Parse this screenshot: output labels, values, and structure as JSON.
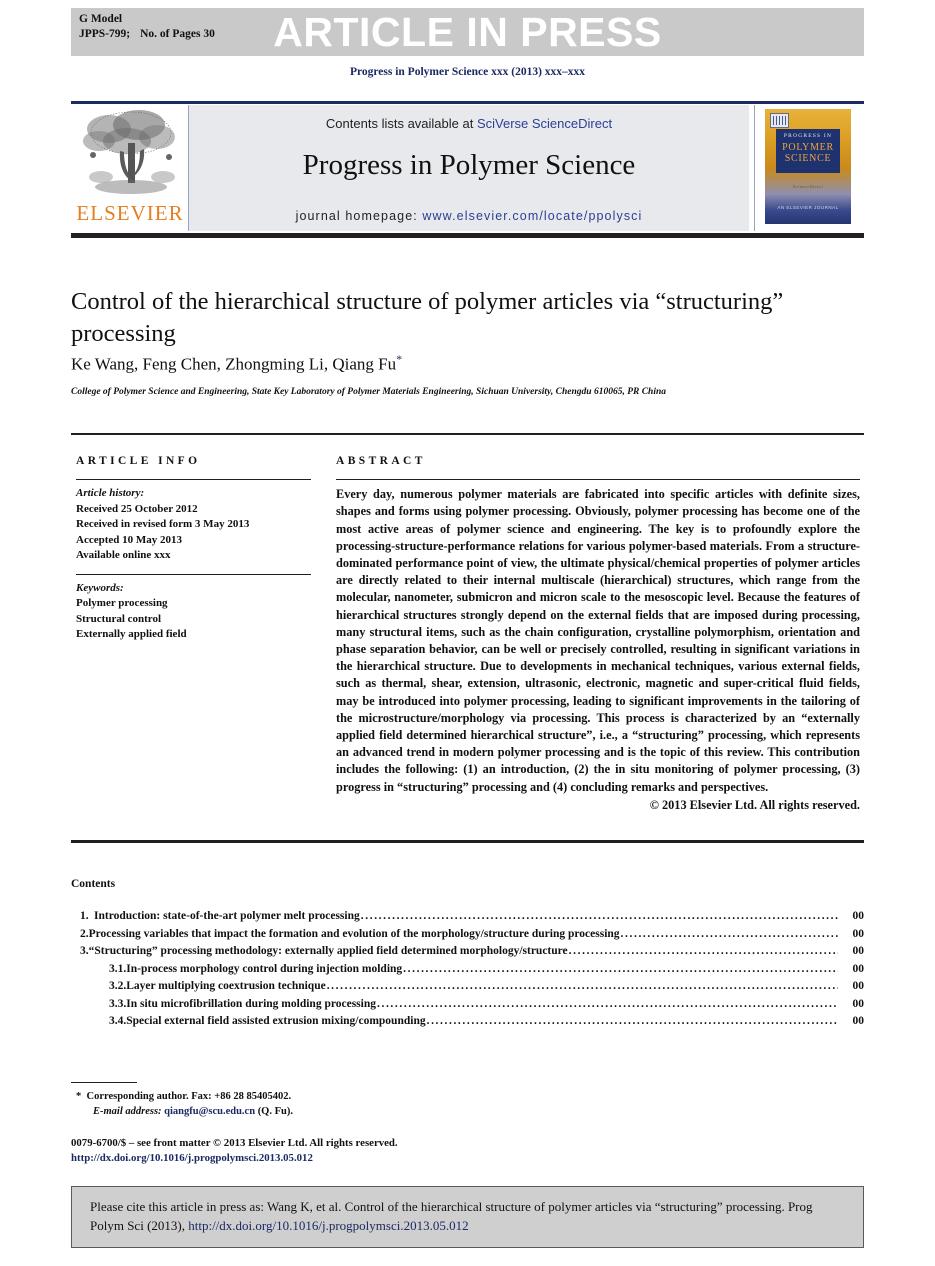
{
  "banner": {
    "gmodel_label": "G Model",
    "journal_code": "JPPS-799;",
    "pages_label": "No. of Pages 30",
    "press_title": "ARTICLE IN PRESS",
    "bg_color": "#c9c9c9"
  },
  "journal_line": "Progress in Polymer Science xxx (2013) xxx–xxx",
  "masthead": {
    "publisher": "ELSEVIER",
    "contents_prefix": "Contents lists available at ",
    "contents_link": "SciVerse ScienceDirect",
    "journal_name": "Progress in Polymer Science",
    "homepage_label": "journal homepage: ",
    "homepage_url": "www.elsevier.com/locate/ppolysci",
    "cover": {
      "top_line": "PROGRESS IN",
      "main_line_1": "POLYMER",
      "main_line_2": "SCIENCE",
      "mid_line": "ScienceDirect",
      "bottom_line": "AN ELSEVIER JOURNAL",
      "accent_color": "#efa63a",
      "panel_color": "#1f3270"
    },
    "link_color": "#2b3f92"
  },
  "article": {
    "title": "Control of the hierarchical structure of polymer articles via “structuring” processing",
    "authors": "Ke Wang, Feng Chen, Zhongming Li, Qiang Fu",
    "author_star": "*",
    "affiliation": "College of Polymer Science and Engineering, State Key Laboratory of Polymer Materials Engineering, Sichuan University, Chengdu 610065, PR China"
  },
  "info": {
    "heading": "ARTICLE INFO",
    "history_label": "Article history:",
    "history": [
      "Received 25 October 2012",
      "Received in revised form 3 May 2013",
      "Accepted 10 May 2013",
      "Available online xxx"
    ],
    "keywords_label": "Keywords:",
    "keywords": [
      "Polymer processing",
      "Structural control",
      "Externally applied field"
    ]
  },
  "abstract": {
    "heading": "ABSTRACT",
    "body": "Every day, numerous polymer materials are fabricated into specific articles with definite sizes, shapes and forms using polymer processing. Obviously, polymer processing has become one of the most active areas of polymer science and engineering. The key is to profoundly explore the processing-structure-performance relations for various polymer-based materials. From a structure-dominated performance point of view, the ultimate physical/chemical properties of polymer articles are directly related to their internal multiscale (hierarchical) structures, which range from the molecular, nanometer, submicron and micron scale to the mesoscopic level. Because the features of hierarchical structures strongly depend on the external fields that are imposed during processing, many structural items, such as the chain configuration, crystalline polymorphism, orientation and phase separation behavior, can be well or precisely controlled, resulting in significant variations in the hierarchical structure. Due to developments in mechanical techniques, various external fields, such as thermal, shear, extension, ultrasonic, electronic, magnetic and super-critical fluid fields, may be introduced into polymer processing, leading to significant improvements in the tailoring of the microstructure/morphology via processing. This process is characterized by an “externally applied field determined hierarchical structure”, i.e., a “structuring” processing, which represents an advanced trend in modern polymer processing and is the topic of this review. This contribution includes the following: (1) an introduction, (2) the in situ monitoring of polymer processing, (3) progress in “structuring” processing and (4) concluding remarks and perspectives.",
    "copyright": "© 2013 Elsevier Ltd. All rights reserved."
  },
  "contents": {
    "heading": "Contents",
    "entries": [
      {
        "level": 1,
        "num": "1.",
        "label": "Introduction: state-of-the-art polymer melt processing",
        "page": "00"
      },
      {
        "level": 1,
        "num": "2.",
        "label": "Processing variables that impact the formation and evolution of the morphology/structure during processing",
        "page": "00"
      },
      {
        "level": 1,
        "num": "3.",
        "label": "“Structuring” processing methodology: externally applied field determined morphology/structure",
        "page": "00"
      },
      {
        "level": 2,
        "num": "3.1.",
        "label": "In-process morphology control during injection molding",
        "page": "00"
      },
      {
        "level": 2,
        "num": "3.2.",
        "label": "Layer multiplying coextrusion technique",
        "page": "00"
      },
      {
        "level": 2,
        "num": "3.3.",
        "label": "In situ microfibrillation during molding processing",
        "page": "00"
      },
      {
        "level": 2,
        "num": "3.4.",
        "label": "Special external field assisted extrusion mixing/compounding",
        "page": "00"
      }
    ]
  },
  "footnote": {
    "star": "*",
    "corresponding": "Corresponding author. Fax: +86 28 85405402.",
    "email_label": "E-mail address:",
    "email": "qiangfu@scu.edu.cn",
    "email_suffix": "(Q. Fu).",
    "front_matter": "0079-6700/$ – see front matter © 2013 Elsevier Ltd. All rights reserved.",
    "doi_url": "http://dx.doi.org/10.1016/j.progpolymsci.2013.05.012"
  },
  "citation_box": {
    "text_before": "Please cite this article in press as: Wang K, et al. Control of the hierarchical structure of polymer articles via “structuring” processing. Prog Polym Sci (2013), ",
    "doi": "http://dx.doi.org/10.1016/j.progpolymsci.2013.05.012",
    "bg_color": "#cfcfcf"
  }
}
